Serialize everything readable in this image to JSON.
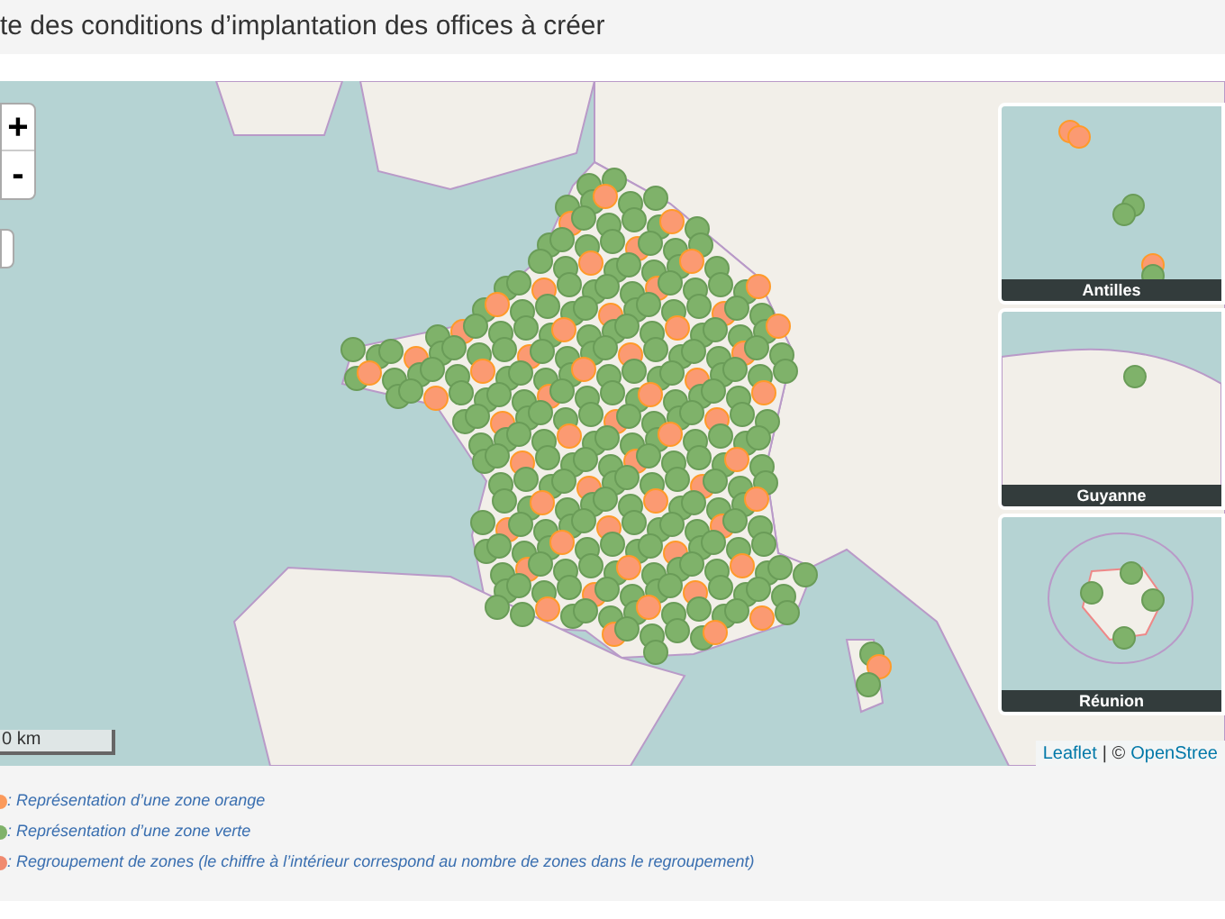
{
  "title": "te des conditions d’implantation des offices à créer",
  "map": {
    "zoom_in": "+",
    "zoom_out": "-",
    "scale": "0 km",
    "attribution": {
      "leaflet": "Leaflet",
      "separator": "| ©",
      "osm": "OpenStree"
    },
    "insets": [
      {
        "label": "Antilles"
      },
      {
        "label": "Guyanne"
      },
      {
        "label": "Réunion"
      }
    ]
  },
  "legend": [
    {
      "text": ": Représentation d’une zone orange",
      "color": "#fb9a5c"
    },
    {
      "text": ": Représentation d’une zone verte",
      "color": "#7fb26a"
    },
    {
      "text": ": Regroupement de zones (le chiffre à l’intérieur correspond au nombre de zones dans le regroupement)",
      "color": "#f08a70"
    }
  ]
}
